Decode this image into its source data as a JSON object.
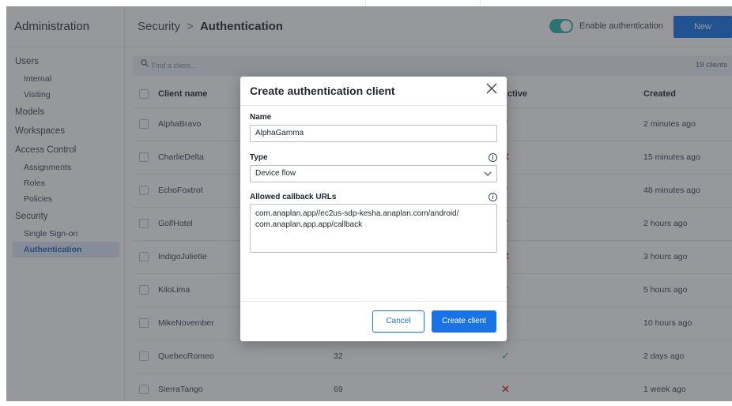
{
  "sidebar": {
    "title": "Administration",
    "items": [
      {
        "label": "Users",
        "level": "top"
      },
      {
        "label": "Internal",
        "level": "sub"
      },
      {
        "label": "Visiting",
        "level": "sub"
      },
      {
        "label": "Models",
        "level": "top"
      },
      {
        "label": "Workspaces",
        "level": "top"
      },
      {
        "label": "Access Control",
        "level": "top"
      },
      {
        "label": "Assignments",
        "level": "sub"
      },
      {
        "label": "Roles",
        "level": "sub"
      },
      {
        "label": "Policies",
        "level": "sub"
      },
      {
        "label": "Security",
        "level": "top"
      },
      {
        "label": "Single Sign-on",
        "level": "sub"
      },
      {
        "label": "Authentication",
        "level": "sub",
        "active": true
      }
    ]
  },
  "header": {
    "breadcrumb_parent": "Security",
    "breadcrumb_separator": ">",
    "breadcrumb_current": "Authentication",
    "toggle_label": "Enable authentication",
    "toggle_on": true,
    "new_button": "New"
  },
  "search": {
    "placeholder": "Find a client...",
    "count": "19 clients"
  },
  "table": {
    "headers": {
      "name": "Client name",
      "active": "Active",
      "created": "Created"
    },
    "rows": [
      {
        "name": "AlphaBravo",
        "num": "",
        "active": true,
        "created": "2 minutes ago"
      },
      {
        "name": "CharlieDelta",
        "num": "",
        "active": false,
        "created": "15 minutes ago"
      },
      {
        "name": "EchoFoxtrot",
        "num": "",
        "active": true,
        "created": "48 minutes ago"
      },
      {
        "name": "GolfHotel",
        "num": "",
        "active": true,
        "created": "2 hours ago"
      },
      {
        "name": "IndigoJuliette",
        "num": "",
        "active": false,
        "created": "3 hours ago"
      },
      {
        "name": "KiloLima",
        "num": "",
        "active": true,
        "created": "5 hours ago"
      },
      {
        "name": "MikeNovember",
        "num": "",
        "active": true,
        "created": "10 hours ago"
      },
      {
        "name": "QuebecRomeo",
        "num": "32",
        "active": true,
        "created": "2 days ago"
      },
      {
        "name": "SierraTango",
        "num": "69",
        "active": false,
        "created": "1 week ago"
      }
    ]
  },
  "modal": {
    "title": "Create authentication client",
    "name_label": "Name",
    "name_value": "AlphaGamma",
    "type_label": "Type",
    "type_value": "Device flow",
    "urls_label": "Allowed callback URLs",
    "urls_line1": "com.anaplan.app//ec2us-sdp-kesha.anaplan.com/android/",
    "urls_line2": "com.anaplan.app.app/callback",
    "cancel_button": "Cancel",
    "create_button": "Create client"
  },
  "icons": {
    "check": "check-icon",
    "cross": "cross-icon",
    "info": "info-icon",
    "close": "close-icon",
    "search": "search-icon",
    "chevron": "chevron-down-icon"
  },
  "colors": {
    "accent": "#1973e6",
    "toggle": "#2bb3a6",
    "active_check": "#2bb37a",
    "inactive_cross": "#e03c3c"
  }
}
